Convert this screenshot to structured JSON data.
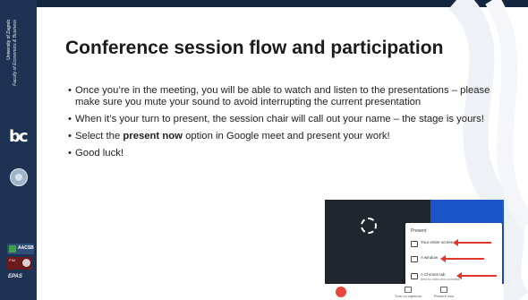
{
  "sidebar": {
    "vertical_text_1": "University of Zagreb",
    "vertical_text_2": "Faculty of Economics & Business",
    "logo": "bc",
    "badge_aacsb": "AACSB",
    "badge_pim": "PIM",
    "badge_epas": "EPAS"
  },
  "title": "Conference session flow and participation",
  "bullets": [
    {
      "dot": "•",
      "text": "Once you’re in the meeting, you will be able to watch and listen to the presentations – please make sure you mute your sound to avoid interrupting the current presentation"
    },
    {
      "dot": "•",
      "text": "When it’s your turn to present, the session chair will call out your name – the stage is yours!"
    },
    {
      "dot": "•",
      "pre": "Select the ",
      "bold": "present now",
      "post": " option in Google meet and present your work!"
    },
    {
      "dot": "•",
      "text": "Good luck!"
    }
  ],
  "screenshot": {
    "menu_title": "Present",
    "items": [
      {
        "label": "Your entire screen",
        "sub": ""
      },
      {
        "label": "A window",
        "sub": ""
      },
      {
        "label": "A Chrome tab",
        "sub": "Best for video and animation"
      }
    ],
    "bar_buttons": [
      "Turn on captions",
      "Present now"
    ],
    "arrow_color": "#e0362c"
  },
  "colors": {
    "sidebar": "#1e3353",
    "accent": "#1a56c8"
  }
}
